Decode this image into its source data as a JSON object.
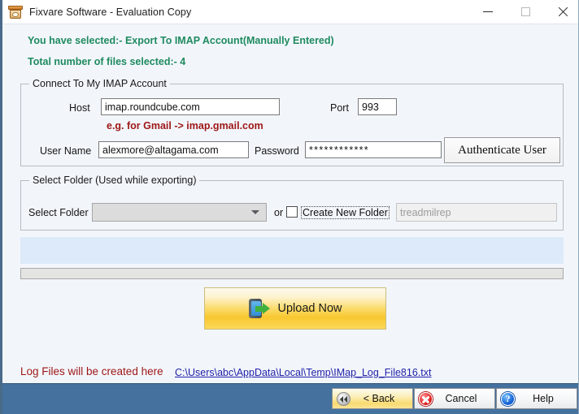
{
  "window": {
    "title": "Fixvare Software - Evaluation Copy",
    "icon": "archive-box-icon",
    "controls": {
      "minimize": "minimize-icon",
      "maximize": "maximize-icon",
      "close": "close-icon"
    }
  },
  "banner": {
    "line1": "You have selected:- Export  To  IMAP Account(Manually Entered)",
    "line2": "Total number of files selected:- 4",
    "color": "#1f8a5f"
  },
  "imap_group": {
    "title": "Connect To My IMAP Account",
    "host_label": "Host",
    "host_value": "imap.roundcube.com",
    "hint": "e.g. for Gmail -> imap.gmail.com",
    "hint_color": "#9e1616",
    "port_label": "Port",
    "port_value": "993",
    "username_label": "User Name",
    "username_value": "alexmore@altagama.com",
    "password_label": "Password",
    "password_value": "************",
    "authenticate_label": "Authenticate User"
  },
  "folder_group": {
    "title": "Select Folder (Used while exporting)",
    "select_folder_label": "Select Folder",
    "select_folder_value": "",
    "dropdown_icon": "chevron-down-icon",
    "or_label": "or",
    "create_new_folder_label": "Create New Folder",
    "create_new_folder_checked": false,
    "new_folder_value": "treadmilrep"
  },
  "status": {
    "log_text": "",
    "progress_value": 0
  },
  "upload": {
    "label": "Upload Now",
    "icon": "export-arrow-icon"
  },
  "logfiles": {
    "label": "Log Files will be created here",
    "path": "C:\\Users\\abc\\AppData\\Local\\Temp\\IMap_Log_File816.txt",
    "label_color": "#9e1616",
    "link_color": "#1f1fa8"
  },
  "bottom_bar": {
    "background": "#44719d",
    "back_label": "< Back",
    "back_icon": "rewind-icon",
    "cancel_label": "Cancel",
    "cancel_icon": "cancel-x-icon",
    "help_label": "Help",
    "help_icon": "question-mark-icon",
    "ghost_text": ""
  }
}
